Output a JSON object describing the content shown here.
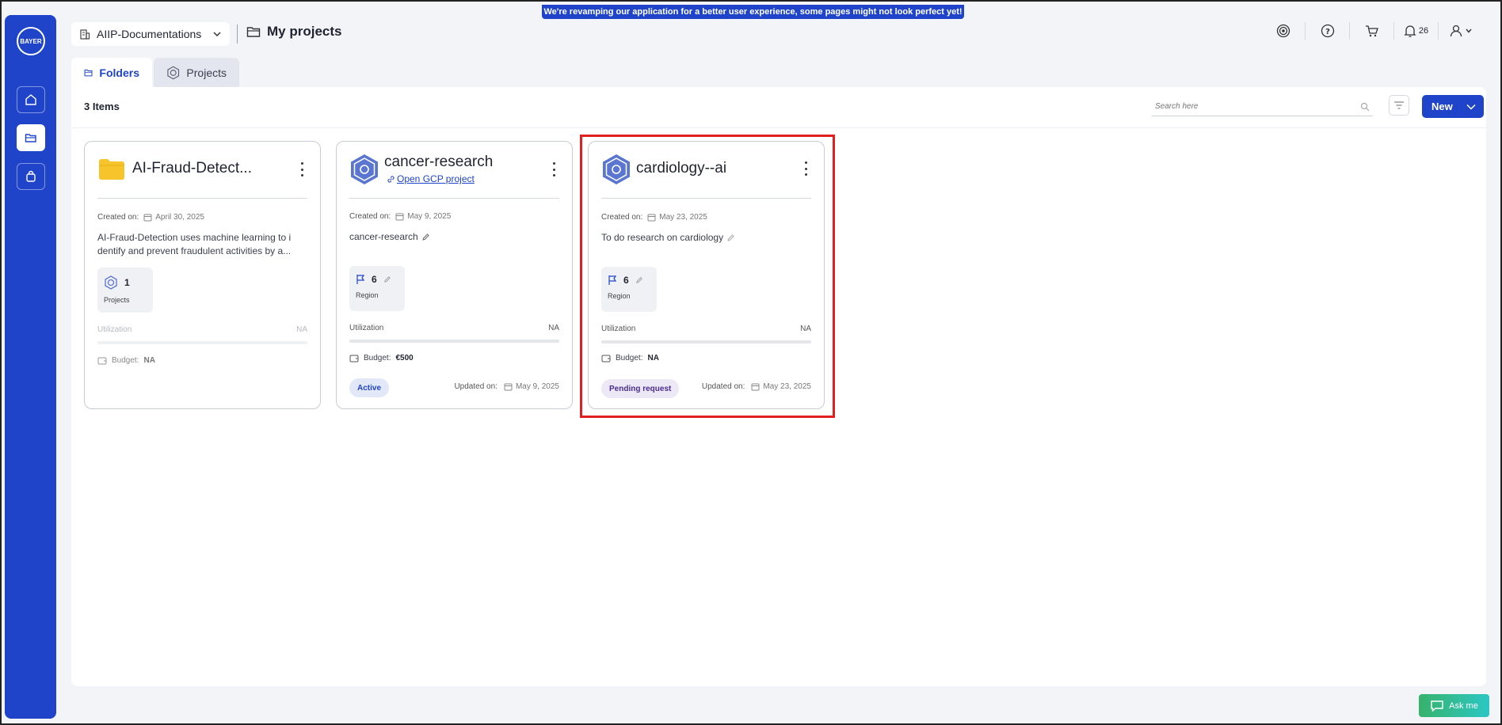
{
  "banner": "We're revamping our application for a better user experience, some pages might not look perfect yet!",
  "brand": {
    "logo_text": "BAYER"
  },
  "workspace": {
    "label": "AIIP-Documentations"
  },
  "page": {
    "title": "My projects"
  },
  "header": {
    "notifications_count": "26"
  },
  "tabs": [
    {
      "label": "Folders"
    },
    {
      "label": "Projects"
    }
  ],
  "toolbar": {
    "items_count": "3 Items",
    "search_placeholder": "Search here",
    "new_label": "New"
  },
  "cards": [
    {
      "title": "AI-Fraud-Detect...",
      "created_label": "Created on:",
      "created_date": "April 30, 2025",
      "description": "AI-Fraud-Detection uses machine learning to i dentify and prevent fraudulent activities by a...",
      "stat_value": "1",
      "stat_label": "Projects",
      "util_label": "Utilization",
      "util_value": "NA",
      "budget_label": "Budget:",
      "budget_value": "NA"
    },
    {
      "title": "cancer-research",
      "link": "Open GCP project",
      "created_label": "Created on:",
      "created_date": "May 9, 2025",
      "description": "cancer-research",
      "stat_value": "6",
      "stat_label": "Region",
      "util_label": "Utilization",
      "util_value": "NA",
      "budget_label": "Budget:",
      "budget_value": "€500",
      "status": "Active",
      "updated_label": "Updated on:",
      "updated_date": "May 9, 2025"
    },
    {
      "title": "cardiology--ai",
      "created_label": "Created on:",
      "created_date": "May 23, 2025",
      "description": "To do research on cardiology",
      "stat_value": "6",
      "stat_label": "Region",
      "util_label": "Utilization",
      "util_value": "NA",
      "budget_label": "Budget:",
      "budget_value": "NA",
      "status": "Pending request",
      "updated_label": "Updated on:",
      "updated_date": "May 23, 2025"
    }
  ],
  "ask": {
    "label": "Ask me"
  },
  "colors": {
    "brand_blue": "#1f44c9",
    "highlight_red": "#e02020",
    "folder_yellow": "#f7c52b"
  }
}
